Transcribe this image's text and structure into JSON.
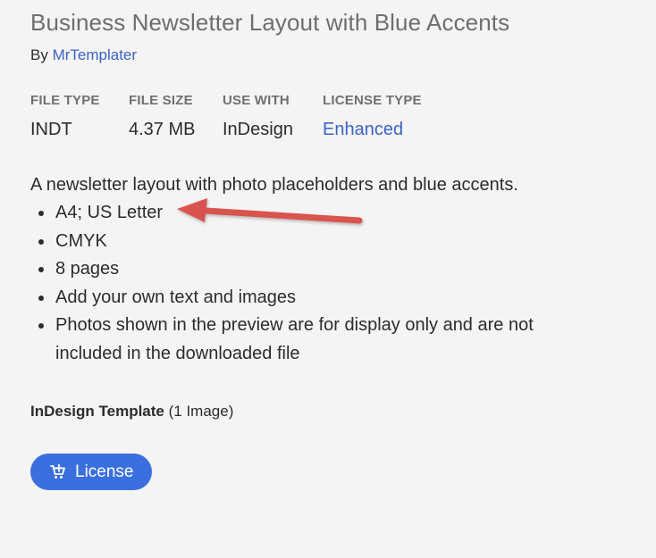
{
  "header": {
    "title": "Business Newsletter Layout with Blue Accents",
    "by_label": "By",
    "author": "MrTemplater"
  },
  "meta": {
    "file_type_label": "FILE TYPE",
    "file_type_value": "INDT",
    "file_size_label": "FILE SIZE",
    "file_size_value": "4.37 MB",
    "use_with_label": "USE WITH",
    "use_with_value": "InDesign",
    "license_type_label": "LICENSE TYPE",
    "license_type_value": "Enhanced"
  },
  "description": "A newsletter layout with photo placeholders and blue accents.",
  "bullets": [
    "A4; US Letter",
    "CMYK",
    "8 pages",
    "Add your own text and images",
    "Photos shown in the preview are for display only and are not included in the downloaded file"
  ],
  "template": {
    "name": "InDesign Template",
    "count": "(1 Image)"
  },
  "license_button": {
    "label": "License",
    "icon": "cart-plus-icon"
  },
  "annotation": {
    "icon": "red-arrow-icon",
    "color": "#d9534f"
  },
  "colors": {
    "link": "#3b63c7",
    "button": "#3b6fe0",
    "background": "#f4f4f4"
  }
}
